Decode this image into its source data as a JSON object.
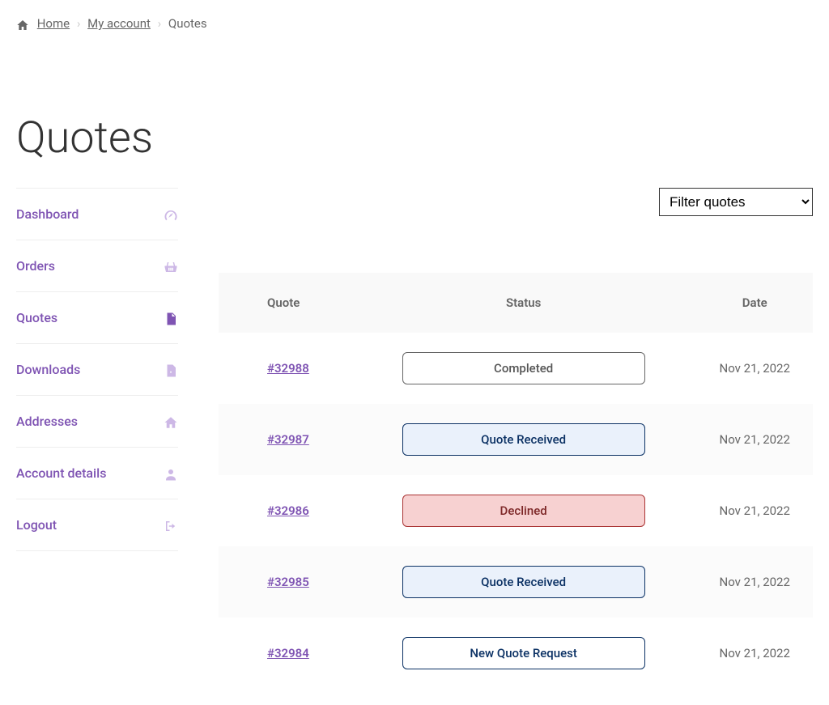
{
  "breadcrumb": {
    "home": "Home",
    "myaccount": "My account",
    "current": "Quotes"
  },
  "page_title": "Quotes",
  "sidebar": {
    "items": [
      {
        "label": "Dashboard",
        "icon": "dashboard"
      },
      {
        "label": "Orders",
        "icon": "basket"
      },
      {
        "label": "Quotes",
        "icon": "file",
        "active": true
      },
      {
        "label": "Downloads",
        "icon": "download-file"
      },
      {
        "label": "Addresses",
        "icon": "home"
      },
      {
        "label": "Account details",
        "icon": "user"
      },
      {
        "label": "Logout",
        "icon": "logout"
      }
    ]
  },
  "filter": {
    "selected": "Filter quotes",
    "options": [
      "Filter quotes"
    ]
  },
  "table": {
    "headers": [
      "Quote",
      "Status",
      "Date"
    ],
    "rows": [
      {
        "id": "#32988",
        "status": "Completed",
        "status_key": "completed",
        "date": "Nov 21, 2022"
      },
      {
        "id": "#32987",
        "status": "Quote Received",
        "status_key": "received",
        "date": "Nov 21, 2022"
      },
      {
        "id": "#32986",
        "status": "Declined",
        "status_key": "declined",
        "date": "Nov 21, 2022"
      },
      {
        "id": "#32985",
        "status": "Quote Received",
        "status_key": "received",
        "date": "Nov 21, 2022"
      },
      {
        "id": "#32984",
        "status": "New Quote Request",
        "status_key": "new",
        "date": "Nov 21, 2022"
      }
    ]
  }
}
